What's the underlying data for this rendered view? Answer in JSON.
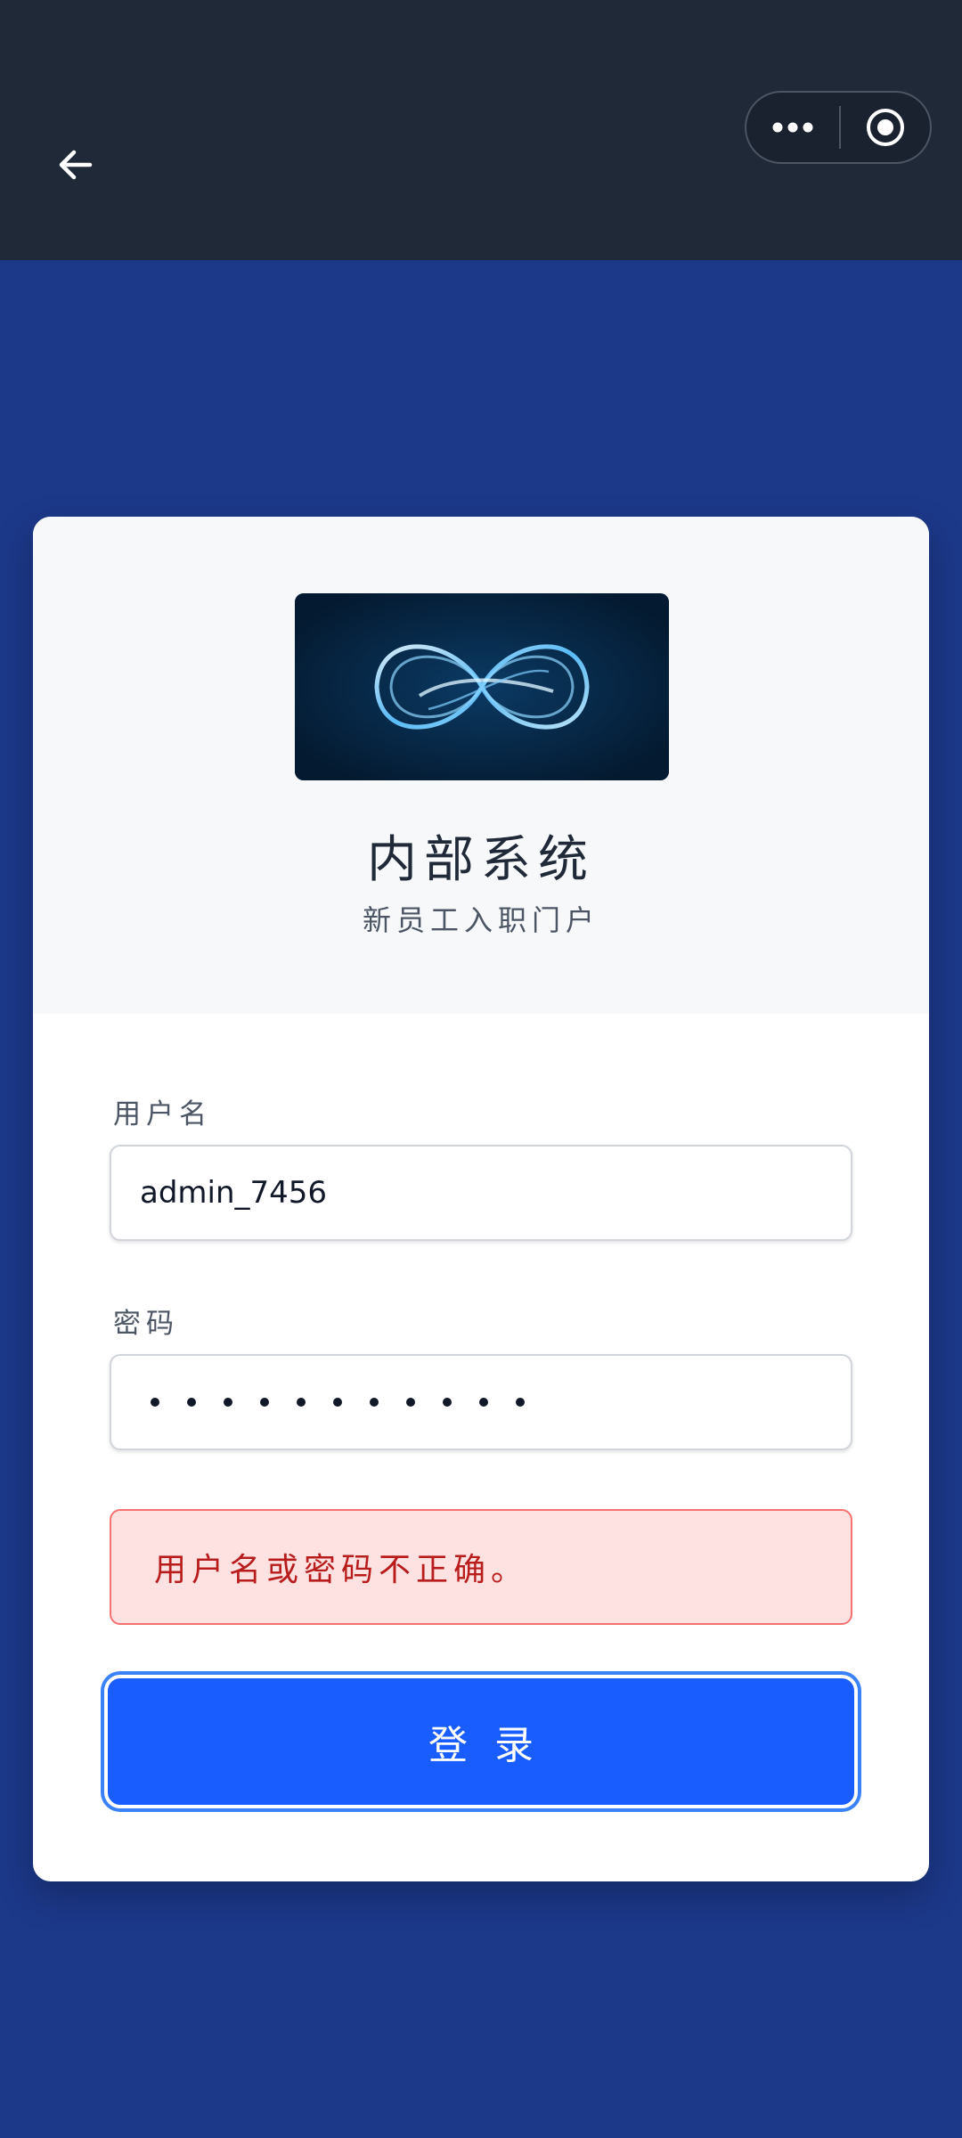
{
  "header": {
    "back_icon": "arrow-left-icon",
    "more_icon": "more-dots-icon",
    "close_icon": "target-circle-icon",
    "background": "#1f2937"
  },
  "page": {
    "background": "#1c3889"
  },
  "card": {
    "logo_icon": "infinity-logo",
    "title": "内部系统",
    "subtitle": "新员工入职门户"
  },
  "form": {
    "username_label": "用户名",
    "username_value": "admin_7456",
    "password_label": "密码",
    "password_dot_count": 11,
    "error_message": "用户名或密码不正确。",
    "login_label": "登录",
    "accent": "#1a5dff",
    "error_color": "#b91c1c"
  }
}
